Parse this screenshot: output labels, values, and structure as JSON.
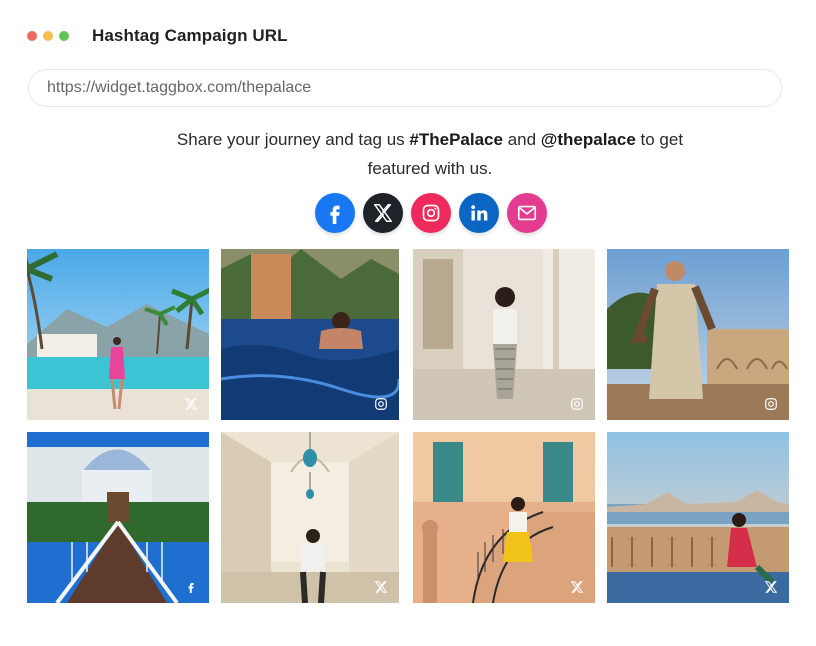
{
  "window": {
    "title": "Hashtag Campaign URL",
    "controls": [
      {
        "name": "close",
        "color": "#ee6a5e"
      },
      {
        "name": "minimize",
        "color": "#f4bf4f"
      },
      {
        "name": "maximize",
        "color": "#61c454"
      }
    ]
  },
  "url_bar": {
    "value": "https://widget.taggbox.com/thepalace"
  },
  "tagline": {
    "part1": "Share your journey and tag us ",
    "hashtag": "#ThePalace",
    "part2": " and ",
    "handle": "@thepalace",
    "part3": " to get featured with us."
  },
  "share_buttons": [
    {
      "name": "facebook",
      "icon": "facebook-icon",
      "color": "#1877f2"
    },
    {
      "name": "x",
      "icon": "x-icon",
      "color": "#1f2329"
    },
    {
      "name": "instagram",
      "icon": "instagram-icon",
      "color": "#ee2a5c"
    },
    {
      "name": "linkedin",
      "icon": "linkedin-icon",
      "color": "#0a66c2"
    },
    {
      "name": "email",
      "icon": "email-icon",
      "color": "#e33b8f"
    }
  ],
  "posts": [
    {
      "id": 1,
      "scene": "pool-with-palms",
      "source_icon": "x-icon"
    },
    {
      "id": 2,
      "scene": "man-in-pool",
      "source_icon": "instagram-icon"
    },
    {
      "id": 3,
      "scene": "woman-in-hall",
      "source_icon": "instagram-icon"
    },
    {
      "id": 4,
      "scene": "man-in-courtyard",
      "source_icon": "instagram-icon"
    },
    {
      "id": 5,
      "scene": "palace-bridge",
      "source_icon": "facebook-icon"
    },
    {
      "id": 6,
      "scene": "corridor-with-lanterns",
      "source_icon": "x-icon"
    },
    {
      "id": 7,
      "scene": "grand-staircase",
      "source_icon": "x-icon"
    },
    {
      "id": 8,
      "scene": "lakeside-sunset",
      "source_icon": "x-icon"
    }
  ]
}
